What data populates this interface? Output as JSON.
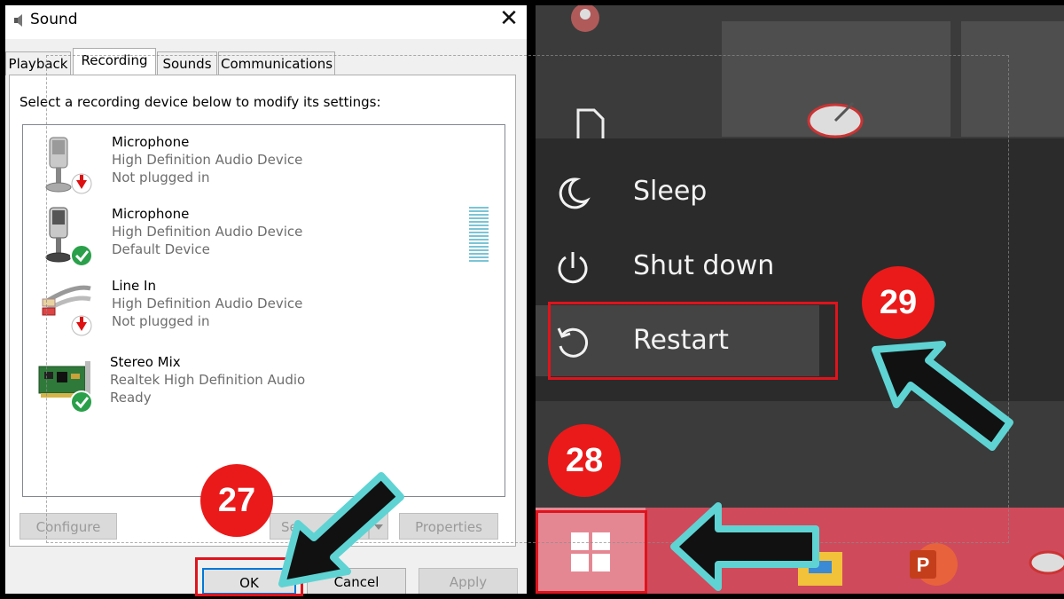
{
  "dialog": {
    "title": "Sound",
    "close_glyph": "✕",
    "tabs": [
      {
        "label": "Playback",
        "active": false
      },
      {
        "label": "Recording",
        "active": true
      },
      {
        "label": "Sounds",
        "active": false
      },
      {
        "label": "Communications",
        "active": false
      }
    ],
    "instruction": "Select a recording device below to modify its settings:",
    "devices": [
      {
        "name": "Microphone",
        "driver": "High Definition Audio Device",
        "status": "Not plugged in",
        "icon": "microphone-icon",
        "badge": "unplugged"
      },
      {
        "name": "Microphone",
        "driver": "High Definition Audio Device",
        "status": "Default Device",
        "icon": "microphone-icon",
        "badge": "ok"
      },
      {
        "name": "Line In",
        "driver": "High Definition Audio Device",
        "status": "Not plugged in",
        "icon": "line-in-cable-icon",
        "badge": "unplugged"
      },
      {
        "name": "Stereo Mix",
        "driver": "Realtek High Definition Audio",
        "status": "Ready",
        "icon": "sound-card-icon",
        "badge": "ok"
      }
    ],
    "buttons": {
      "configure": "Configure",
      "set_default": "Se",
      "properties": "Properties",
      "ok": "OK",
      "cancel": "Cancel",
      "apply": "Apply"
    }
  },
  "power_menu": {
    "items": [
      {
        "label": "Sleep",
        "icon": "moon-icon"
      },
      {
        "label": "Shut down",
        "icon": "power-icon"
      },
      {
        "label": "Restart",
        "icon": "restart-icon"
      }
    ]
  },
  "annotations": {
    "step_ok": "27",
    "step_start": "28",
    "step_restart": "29",
    "badge_color": "#ea1a1a",
    "arrow_outline_color": "#5fd3d3",
    "highlight_color": "#e0131c"
  },
  "colors": {
    "taskbar": "#cf4a5b",
    "menu_bg": "#2b2b2b",
    "dialog_bg": "#f0f0f0"
  }
}
